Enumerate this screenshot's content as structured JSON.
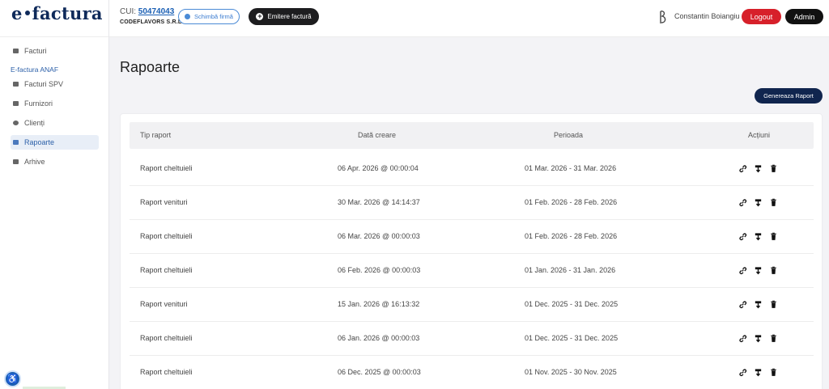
{
  "header": {
    "logo_left": "e",
    "logo_right": "factura",
    "cui_label": "CUI:",
    "cui_value": "50474043",
    "company": "CODEFLAVORS S.R.L",
    "change_company": "Schimbă firmă",
    "emit_invoice": "Emitere factură",
    "user_name": "Constantin Boiangiu",
    "logout": "Logout",
    "admin": "Admin",
    "colors": {
      "logout": "#d7202a",
      "admin": "#111111",
      "primary": "#10254e",
      "accent": "#1a5fb4"
    }
  },
  "sidebar": {
    "top_item": "Facturi",
    "section": "E-factura ANAF",
    "items": [
      {
        "label": "Facturi SPV",
        "icon": "document-icon"
      },
      {
        "label": "Furnizori",
        "icon": "supplier-icon"
      },
      {
        "label": "Clienți",
        "icon": "clients-icon"
      },
      {
        "label": "Rapoarte",
        "icon": "table-icon",
        "active": true
      },
      {
        "label": "Arhive",
        "icon": "archive-icon"
      }
    ]
  },
  "main": {
    "title": "Rapoarte",
    "generate_button": "Genereaza Raport",
    "columns": [
      "Tip raport",
      "Dată creare",
      "Perioada",
      "Acțiuni"
    ],
    "rows": [
      {
        "type": "Raport cheltuieli",
        "created": "06 Apr. 2026 @ 00:00:04",
        "period": "01 Mar. 2026 - 31 Mar. 2026"
      },
      {
        "type": "Raport venituri",
        "created": "30 Mar. 2026 @ 14:14:37",
        "period": "01 Feb. 2026 - 28 Feb. 2026"
      },
      {
        "type": "Raport cheltuieli",
        "created": "06 Mar. 2026 @ 00:00:03",
        "period": "01 Feb. 2026 - 28 Feb. 2026"
      },
      {
        "type": "Raport cheltuieli",
        "created": "06 Feb. 2026 @ 00:00:03",
        "period": "01 Jan. 2026 - 31 Jan. 2026"
      },
      {
        "type": "Raport venituri",
        "created": "15 Jan. 2026 @ 16:13:32",
        "period": "01 Dec. 2025 - 31 Dec. 2025"
      },
      {
        "type": "Raport cheltuieli",
        "created": "06 Jan. 2026 @ 00:00:03",
        "period": "01 Dec. 2025 - 31 Dec. 2025"
      },
      {
        "type": "Raport cheltuieli",
        "created": "06 Dec. 2025 @ 00:00:03",
        "period": "01 Nov. 2025 - 30 Nov. 2025"
      }
    ]
  }
}
